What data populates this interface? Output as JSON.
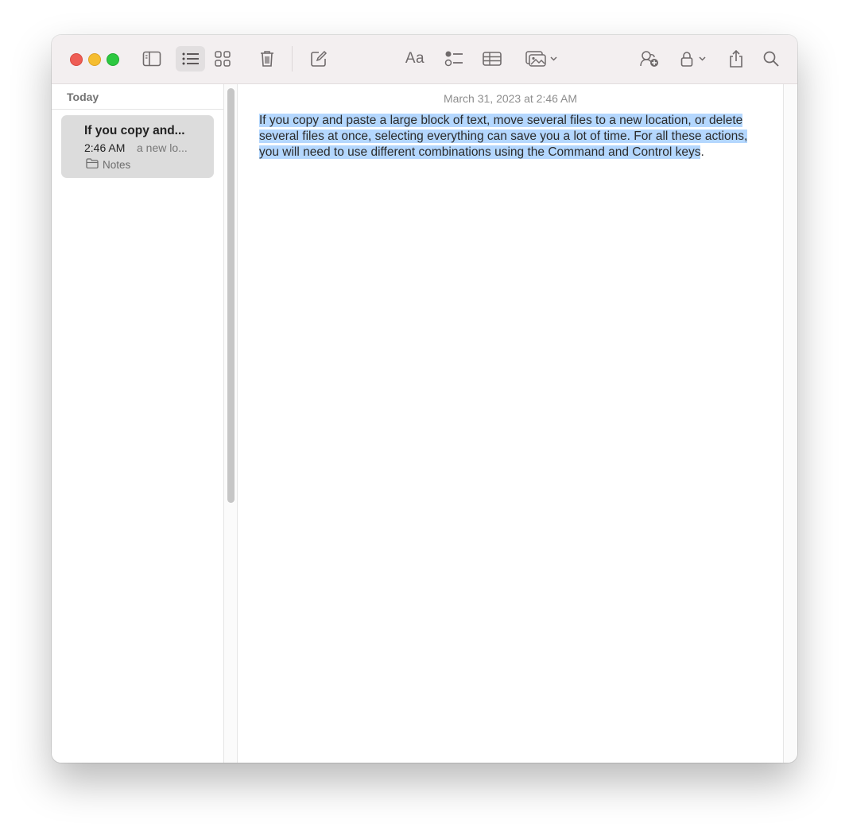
{
  "window": {
    "traffic_lights": [
      "close",
      "minimize",
      "zoom"
    ]
  },
  "toolbar": {
    "format_label": "Aa",
    "icons": [
      "sidebar-toggle-icon",
      "list-view-icon",
      "gallery-view-icon",
      "trash-icon",
      "compose-icon",
      "format-icon",
      "checklist-icon",
      "table-icon",
      "media-icon",
      "collaborate-icon",
      "lock-icon",
      "share-icon",
      "search-icon"
    ]
  },
  "sidebar": {
    "section_label": "Today",
    "notes": [
      {
        "title": "If you copy and...",
        "time": "2:46 AM",
        "preview": "a new lo...",
        "folder": "Notes"
      }
    ]
  },
  "editor": {
    "date": "March 31, 2023 at 2:46 AM",
    "selected_text": "If you copy and paste a large block of text, move several files to a new location, or delete several files at once, selecting everything can save you a lot of time. For all these actions, you will need to use different combinations using the Command and Control keys",
    "trailing_text": "."
  },
  "colors": {
    "selection": "#b4d7fe",
    "close": "#ee5d55",
    "minimize": "#f5bd30",
    "zoom": "#2cc840"
  }
}
